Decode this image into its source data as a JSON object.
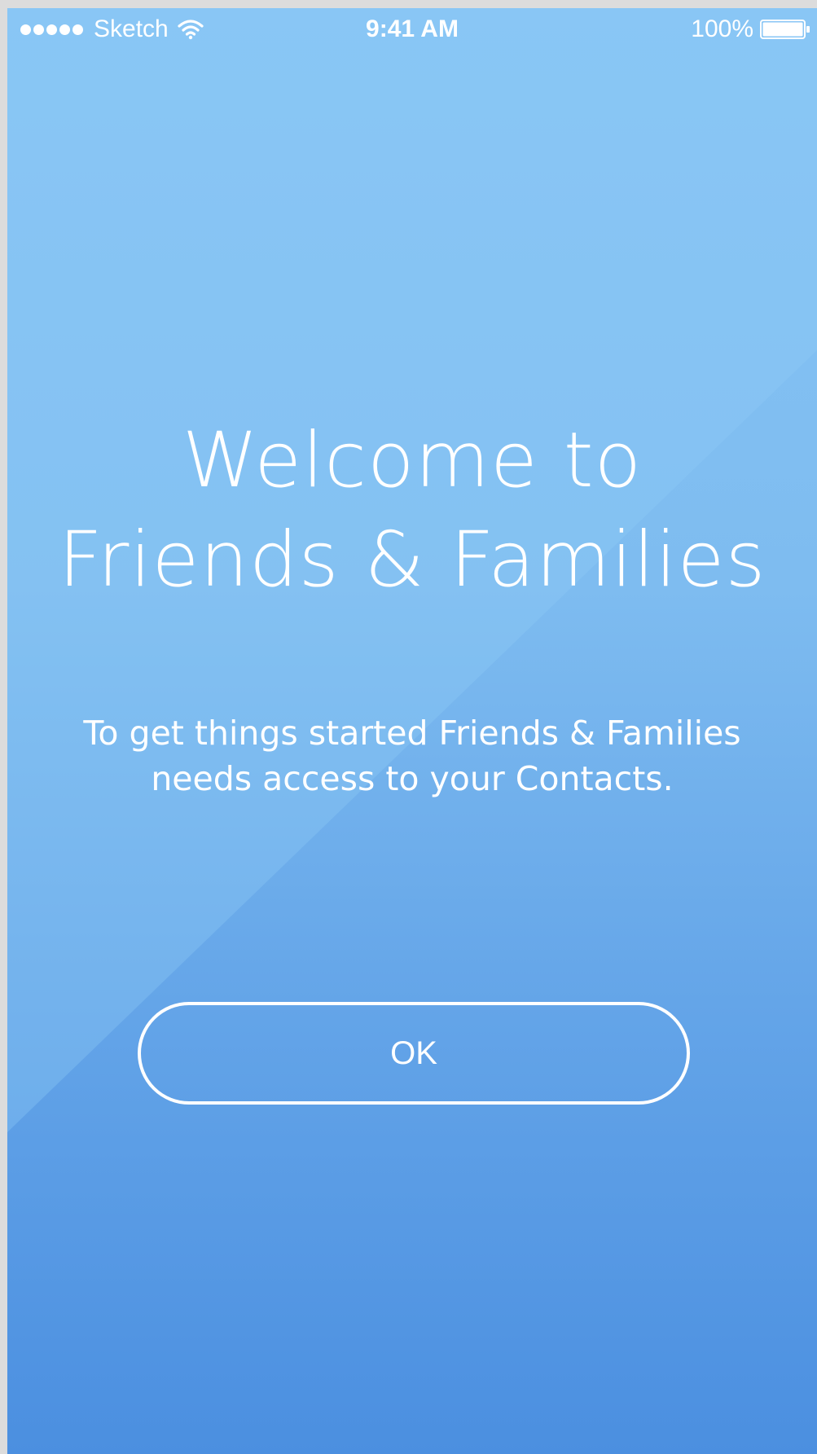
{
  "status_bar": {
    "carrier": "Sketch",
    "time": "9:41 AM",
    "battery_percent": "100%",
    "signal_icon": "signal-dots-icon",
    "wifi_icon": "wifi-icon",
    "battery_icon": "battery-icon",
    "battery_level": 1.0
  },
  "welcome": {
    "title_line1": "Welcome to",
    "title_line2": "Friends & Families",
    "subtitle_line1": "To get things started Friends & Families",
    "subtitle_line2": "needs access to your Contacts."
  },
  "actions": {
    "ok_label": "OK"
  },
  "colors": {
    "gradient_top": "#86c4f4",
    "gradient_bottom": "#4b8fe0",
    "text": "#ffffff"
  }
}
